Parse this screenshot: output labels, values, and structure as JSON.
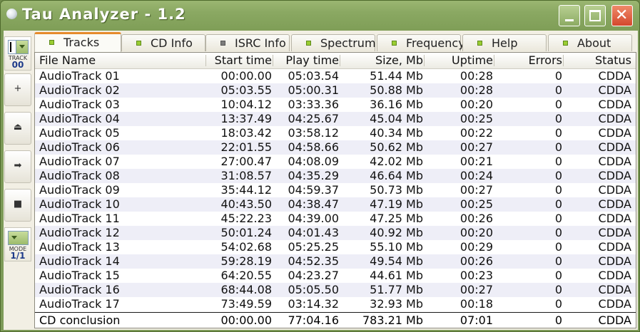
{
  "window": {
    "title": "Tau Analyzer - 1.2",
    "close_glyph": "✕"
  },
  "side": {
    "track_label": "TRACK",
    "track_value": "00",
    "mode_label": "MODE",
    "mode_value": "1/1",
    "buttons": [
      {
        "name": "add-icon",
        "glyph": "+"
      },
      {
        "name": "eject-icon",
        "glyph": "⏏"
      },
      {
        "name": "forward-icon",
        "glyph": "➡"
      },
      {
        "name": "stop-icon",
        "glyph": "■"
      }
    ]
  },
  "tabs": [
    "Tracks",
    "CD Info",
    "ISRC Info",
    "Spectrum",
    "Frequency",
    "Help",
    "About"
  ],
  "columns": [
    "File Name",
    "Start time",
    "Play time",
    "Size, Mb",
    "Uptime",
    "Errors",
    "Status"
  ],
  "rows": [
    [
      "AudioTrack 01",
      "00:00.00",
      "05:03.54",
      "51.44 Mb",
      "00:28",
      "0",
      "CDDA"
    ],
    [
      "AudioTrack 02",
      "05:03.55",
      "05:00.31",
      "50.88 Mb",
      "00:28",
      "0",
      "CDDA"
    ],
    [
      "AudioTrack 03",
      "10:04.12",
      "03:33.36",
      "36.16 Mb",
      "00:20",
      "0",
      "CDDA"
    ],
    [
      "AudioTrack 04",
      "13:37.49",
      "04:25.67",
      "45.04 Mb",
      "00:25",
      "0",
      "CDDA"
    ],
    [
      "AudioTrack 05",
      "18:03.42",
      "03:58.12",
      "40.34 Mb",
      "00:22",
      "0",
      "CDDA"
    ],
    [
      "AudioTrack 06",
      "22:01.55",
      "04:58.66",
      "50.62 Mb",
      "00:27",
      "0",
      "CDDA"
    ],
    [
      "AudioTrack 07",
      "27:00.47",
      "04:08.09",
      "42.02 Mb",
      "00:21",
      "0",
      "CDDA"
    ],
    [
      "AudioTrack 08",
      "31:08.57",
      "04:35.29",
      "46.64 Mb",
      "00:24",
      "0",
      "CDDA"
    ],
    [
      "AudioTrack 09",
      "35:44.12",
      "04:59.37",
      "50.73 Mb",
      "00:27",
      "0",
      "CDDA"
    ],
    [
      "AudioTrack 10",
      "40:43.50",
      "04:38.47",
      "47.19 Mb",
      "00:25",
      "0",
      "CDDA"
    ],
    [
      "AudioTrack 11",
      "45:22.23",
      "04:39.00",
      "47.25 Mb",
      "00:26",
      "0",
      "CDDA"
    ],
    [
      "AudioTrack 12",
      "50:01.24",
      "04:01.43",
      "40.92 Mb",
      "00:20",
      "0",
      "CDDA"
    ],
    [
      "AudioTrack 13",
      "54:02.68",
      "05:25.25",
      "55.10 Mb",
      "00:29",
      "0",
      "CDDA"
    ],
    [
      "AudioTrack 14",
      "59:28.19",
      "04:52.35",
      "49.54 Mb",
      "00:26",
      "0",
      "CDDA"
    ],
    [
      "AudioTrack 15",
      "64:20.55",
      "04:23.27",
      "44.61 Mb",
      "00:23",
      "0",
      "CDDA"
    ],
    [
      "AudioTrack 16",
      "68:44.08",
      "05:05.50",
      "51.77 Mb",
      "00:27",
      "0",
      "CDDA"
    ],
    [
      "AudioTrack 17",
      "73:49.59",
      "03:14.32",
      "32.93 Mb",
      "00:18",
      "0",
      "CDDA"
    ]
  ],
  "total": [
    "CD conclusion",
    "00:00.00",
    "77:04.16",
    "783.21 Mb",
    "07:01",
    "0",
    "CDDA"
  ]
}
